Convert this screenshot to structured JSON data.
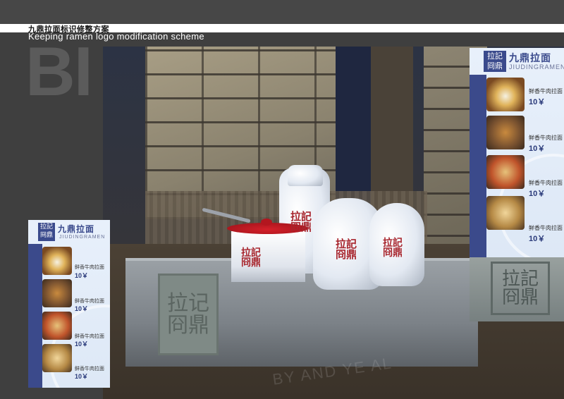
{
  "header": {
    "title_cn": "九鼎拉面标识修整方案",
    "subtitle_en": "Keeping ramen logo modification scheme",
    "big_letters": "BI"
  },
  "scene": {
    "tray_seal_text": "拉记\n冏鼎",
    "stand_seal_text": "拉記\n冏鼎",
    "bottle_logo_text": "拉記\n冏鼎",
    "floor_text": "BY AND YE AL"
  },
  "menu": {
    "logo_text": "拉記\n冏鼎",
    "title_cn": "九鼎拉面",
    "title_en": "JIUDINGRAMEN",
    "items": [
      {
        "name": "鲜香牛肉拉面",
        "price": "10￥"
      },
      {
        "name": "鲜香牛肉拉面",
        "price": "10￥"
      },
      {
        "name": "鲜香牛肉拉面",
        "price": "10￥"
      },
      {
        "name": "鲜香牛肉拉面",
        "price": "10￥"
      }
    ]
  },
  "colors": {
    "background": "#3f3f3f",
    "brand_blue": "#3b4a8b",
    "brand_red": "#a8262e"
  }
}
